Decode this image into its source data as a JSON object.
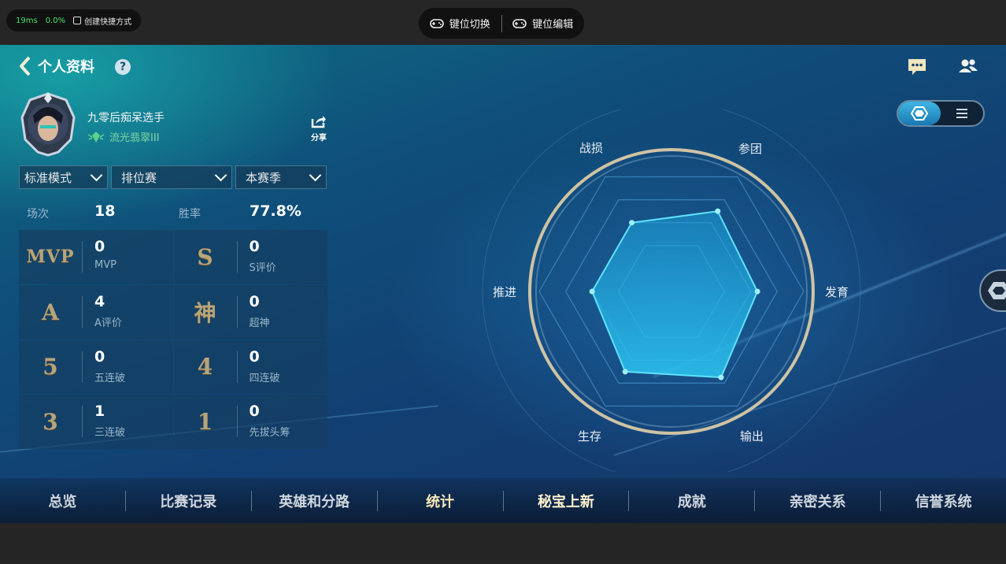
{
  "emulator": {
    "latency": "19ms",
    "cpu": "0.0%",
    "shortcut_label": "创建快捷方式",
    "key_switch_label": "键位切换",
    "key_edit_label": "键位编辑"
  },
  "header": {
    "title": "个人资料",
    "help_symbol": "?"
  },
  "profile": {
    "name": "九零后痴呆选手",
    "rank": "流光翡翠III",
    "share_label": "分享"
  },
  "filters": {
    "mode": "标准模式",
    "match_type": "排位赛",
    "season": "本赛季"
  },
  "summary": {
    "matches_label": "场次",
    "matches_value": "18",
    "winrate_label": "胜率",
    "winrate_value": "77.8%"
  },
  "stats": [
    {
      "icon": "MVP",
      "value": "0",
      "caption": "MVP"
    },
    {
      "icon": "S",
      "value": "0",
      "caption": "S评价"
    },
    {
      "icon": "A",
      "value": "4",
      "caption": "A评价"
    },
    {
      "icon": "神",
      "value": "0",
      "caption": "超神"
    },
    {
      "icon": "5",
      "value": "0",
      "caption": "五连破"
    },
    {
      "icon": "4",
      "value": "0",
      "caption": "四连破"
    },
    {
      "icon": "3",
      "value": "1",
      "caption": "三连破"
    },
    {
      "icon": "1",
      "value": "0",
      "caption": "先拔头筹"
    }
  ],
  "radar": {
    "labels": [
      "战损",
      "参团",
      "发育",
      "输出",
      "生存",
      "推进"
    ],
    "values": [
      0.6,
      0.7,
      0.65,
      0.75,
      0.7,
      0.6
    ]
  },
  "tabs": [
    "总览",
    "比赛记录",
    "英雄和分路",
    "统计",
    "秘宝上新",
    "成就",
    "亲密关系",
    "信誉系统"
  ],
  "active_tab": "统计",
  "colors": {
    "accent_gold": "#b8a47a",
    "radar_fill": "#1ca4e0",
    "latency_green": "#47e26a"
  }
}
